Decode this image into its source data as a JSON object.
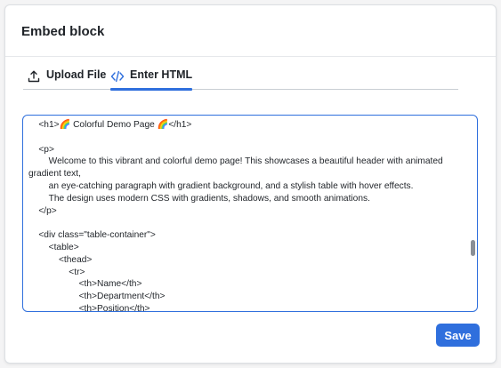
{
  "dialog": {
    "title": "Embed block"
  },
  "tabs": [
    {
      "label": "Upload File",
      "icon": "upload-icon",
      "active": false
    },
    {
      "label": "Enter HTML",
      "icon": "code-icon",
      "active": true
    }
  ],
  "editor": {
    "lines": [
      "    <h1>🌈 Colorful Demo Page 🌈</h1>",
      "",
      "    <p>",
      "        Welcome to this vibrant and colorful demo page! This showcases a beautiful header with animated",
      "gradient text,",
      "        an eye-catching paragraph with gradient background, and a stylish table with hover effects.",
      "        The design uses modern CSS with gradients, shadows, and smooth animations.",
      "    </p>",
      "",
      "    <div class=\"table-container\">",
      "        <table>",
      "            <thead>",
      "                <tr>",
      "                    <th>Name</th>",
      "                    <th>Department</th>",
      "                    <th>Position</th>"
    ]
  },
  "actions": {
    "save_label": "Save"
  },
  "colors": {
    "accent": "#2f6fdd"
  }
}
